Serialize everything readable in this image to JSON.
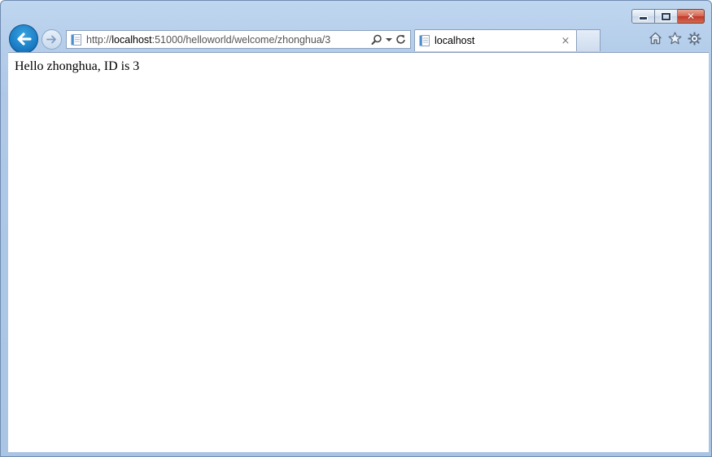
{
  "browser": {
    "address_url_prefix": "http://",
    "address_url_host": "localhost",
    "address_url_rest": ":51000/helloworld/welcome/zhonghua/3",
    "tab_title": "localhost",
    "tab_close_glyph": "×",
    "caption_close_glyph": "✕"
  },
  "page": {
    "message": "Hello zhonghua, ID is 3"
  },
  "icons": {
    "back": "arrow-left-icon",
    "forward": "arrow-right-icon",
    "search": "search-icon",
    "dropdown": "chevron-down-icon",
    "refresh": "refresh-icon",
    "home": "home-icon",
    "favorites": "star-icon",
    "tools": "gear-icon"
  },
  "colors": {
    "accent": "#1b7fc7",
    "close": "#c0392b",
    "frame": "#b4cdea"
  }
}
